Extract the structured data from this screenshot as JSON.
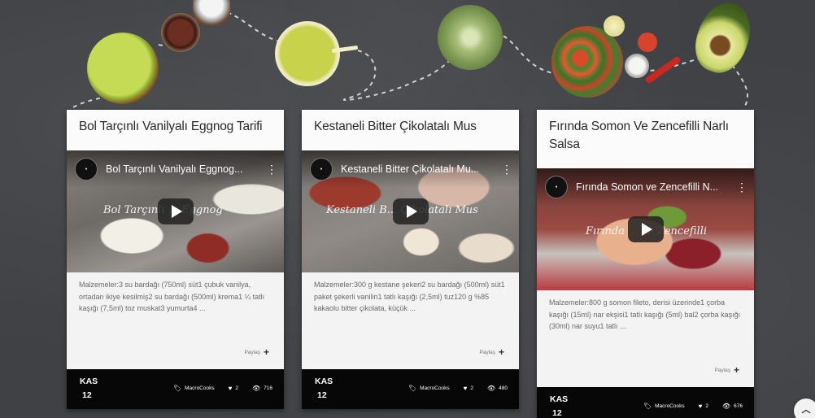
{
  "cards": [
    {
      "title": "Bol Tarçınlı Vanilyalı Eggnog Tarifi",
      "video_title": "Bol Tarçınlı Vanilyalı Eggnog...",
      "video_overlay": "Bol Tarçınlı ... Eggnog",
      "description": "Malzemeler:3 su bardağı (750ml) süt1 çubuk vanilya, ortadan ikiye kesilmiş2 su bardağı (500ml) krema1 ¼ tatlı kaşığı (7,5ml) toz muskat3 yumurta4 ...",
      "share_label": "Paylaş",
      "date_month": "KAS",
      "date_day": "12",
      "tag": "MacroCooks",
      "likes": "2",
      "views": "716"
    },
    {
      "title": "Kestaneli Bitter Çikolatalı Mus",
      "video_title": "Kestaneli Bitter Çikolatalı Mu...",
      "video_overlay": "Kestaneli B... Çikolatalı Mus",
      "description": "Malzemeler:300 g kestane şekeri2 su bardağı (500ml) süt1 paket şekerli vanilin1 tatlı kaşığı (2,5ml) tuz120 g %85 kakaolu bitter çikolata, küçük ...",
      "share_label": "Paylaş",
      "date_month": "KAS",
      "date_day": "12",
      "tag": "MacroCooks",
      "likes": "2",
      "views": "480"
    },
    {
      "title": "Fırında Somon Ve Zencefilli Narlı Salsa",
      "video_title": "Fırında Somon ve Zencefilli N...",
      "video_overlay": "Fırında ... ve Zencefilli",
      "description": "Malzemeler:800 g somon fileto, derisi üzerinde1 çorba kaşığı (15ml) nar ekşisi1 tatlı kaşığı (5ml) bal2 çorba kaşığı (30ml) nar suyu1 tatlı ...",
      "share_label": "Paylaş",
      "date_month": "KAS",
      "date_day": "12",
      "tag": "MacroCooks",
      "likes": "2",
      "views": "676"
    }
  ],
  "icons": {
    "play": "play-icon",
    "kebab": "more-vertical-icon",
    "share": "plus-icon",
    "tag": "tag-icon",
    "heart": "heart-icon",
    "eye": "eye-icon",
    "scroll_top": "chevron-up-icon"
  },
  "colors": {
    "background": "#3f4144",
    "card": "#f3f3f3",
    "footer": "#070707"
  }
}
